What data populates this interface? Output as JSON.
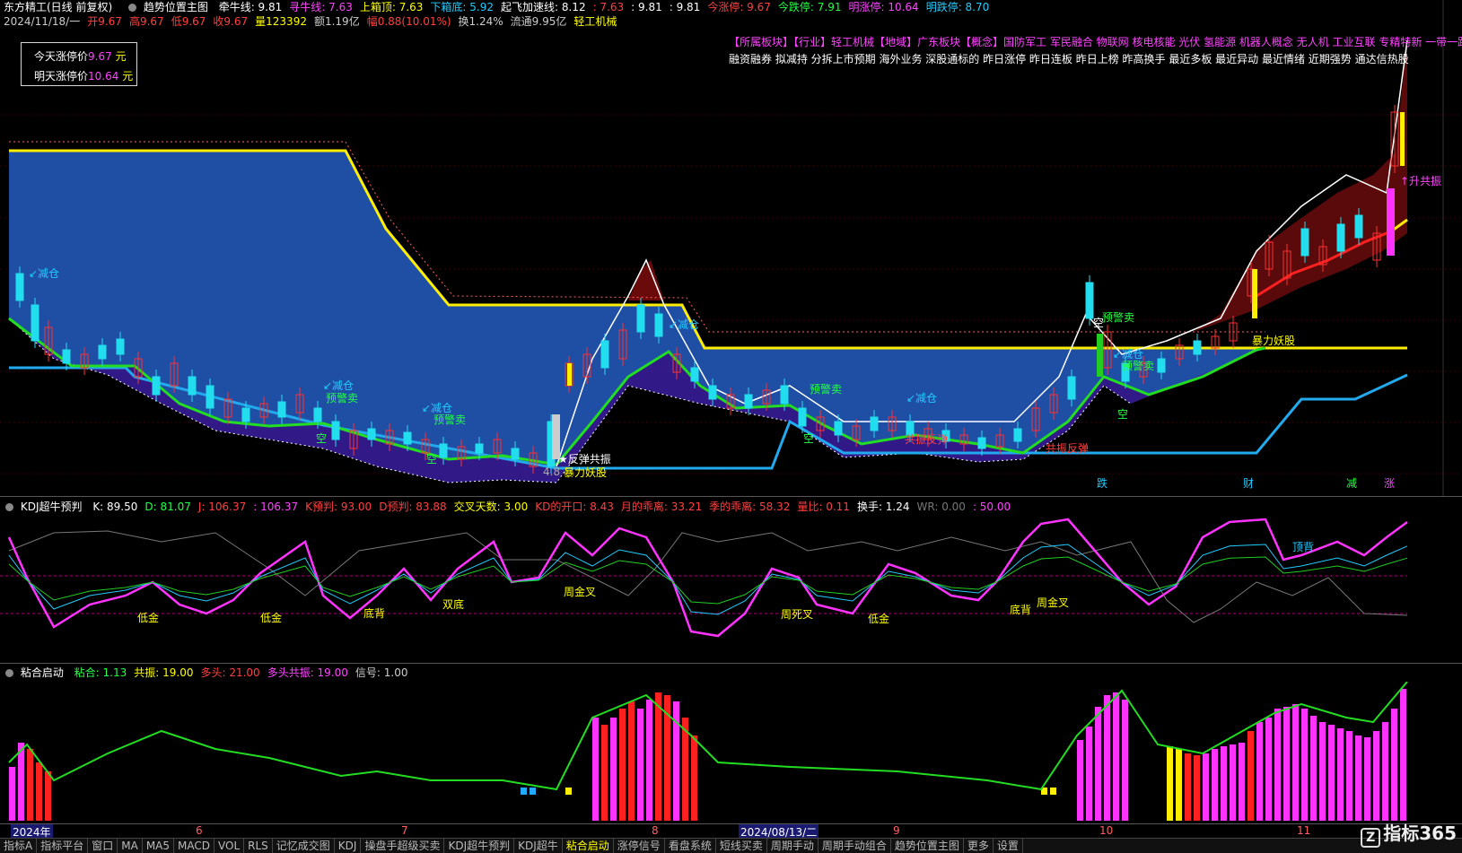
{
  "top": {
    "app": "东方精工(日线 前复权)",
    "indicator": "趋势位置主图",
    "items": [
      {
        "t": "牵牛线: 9.81",
        "c": "#ffffff"
      },
      {
        "t": "寻牛线: 7.63",
        "c": "#ff44ff"
      },
      {
        "t": "上箱顶: 7.63",
        "c": "#ffff00"
      },
      {
        "t": "下箱底: 5.92",
        "c": "#22ccff"
      },
      {
        "t": "起飞加速线: 8.12",
        "c": "#ffffff"
      },
      {
        "t": ": 7.63",
        "c": "#ff4040"
      },
      {
        "t": ": 9.81",
        "c": "#ffffff"
      },
      {
        "t": ": 9.81",
        "c": "#ffffff"
      },
      {
        "t": "今涨停: 9.67",
        "c": "#ff4040"
      },
      {
        "t": "今跌停: 7.91",
        "c": "#22ff44"
      },
      {
        "t": "明涨停: 10.64",
        "c": "#ff44ff"
      },
      {
        "t": "明跌停: 8.70",
        "c": "#22ccff"
      }
    ]
  },
  "quote": {
    "items": [
      {
        "t": "2024/11/18/一",
        "c": "#cccccc"
      },
      {
        "t": "开9.67",
        "c": "#ff4040"
      },
      {
        "t": "高9.67",
        "c": "#ff4040"
      },
      {
        "t": "低9.67",
        "c": "#ff4040"
      },
      {
        "t": "收9.67",
        "c": "#ff4040"
      },
      {
        "t": "量123392",
        "c": "#ffff00"
      },
      {
        "t": "额1.19亿",
        "c": "#cccccc"
      },
      {
        "t": "幅0.88(10.01%)",
        "c": "#ff4040"
      },
      {
        "t": "换1.24%",
        "c": "#cccccc"
      },
      {
        "t": "流通9.95亿",
        "c": "#cccccc"
      },
      {
        "t": "轻工机械",
        "c": "#ffff00"
      }
    ]
  },
  "price_box": {
    "today_label": "今天涨停价",
    "today_value": "9.67",
    "today_unit": "元",
    "tomorrow_label": "明天涨停价",
    "tomorrow_value": "10.64",
    "tomorrow_unit": "元"
  },
  "concepts": {
    "line1": "【所属板块】【行业】轻工机械【地域】广东板块【概念】国防军工 军民融合 物联网 核电核能 光伏 氢能源 机器人概念 无人机 工业互联 专精特新 一带一路",
    "line2": "融资融券 拟减持 分拆上市预期 海外业务 深股通标的 昨日涨停 昨日连板 昨日上榜 昨高换手 最近多板 最近异动 最近情绪 近期强势 通达信热股"
  },
  "annotations": [
    {
      "t": "↙减仓",
      "c": "#22ccff",
      "x": 32,
      "y": 308
    },
    {
      "t": "↙减仓",
      "c": "#22ccff",
      "x": 360,
      "y": 433
    },
    {
      "t": "预警卖",
      "c": "#22ff44",
      "x": 363,
      "y": 447
    },
    {
      "t": "↙减仓",
      "c": "#22ccff",
      "x": 470,
      "y": 458
    },
    {
      "t": "预警卖",
      "c": "#22ff44",
      "x": 483,
      "y": 471
    },
    {
      "t": "↙减仓",
      "c": "#22ccff",
      "x": 745,
      "y": 365
    },
    {
      "t": "预警卖",
      "c": "#22ff44",
      "x": 902,
      "y": 437
    },
    {
      "t": "↙减仓",
      "c": "#22ccff",
      "x": 1010,
      "y": 447
    },
    {
      "t": "预警卖",
      "c": "#22ff44",
      "x": 1228,
      "y": 357
    },
    {
      "t": "↙减仓",
      "c": "#22ccff",
      "x": 1240,
      "y": 398
    },
    {
      "t": "预警卖",
      "c": "#22ff44",
      "x": 1250,
      "y": 411
    },
    {
      "t": "暴力妖股",
      "c": "#ffff00",
      "x": 1395,
      "y": 383
    },
    {
      "t": "★反弹共振",
      "c": "#ffffff",
      "x": 622,
      "y": 515
    },
    {
      "t": "暴力妖股",
      "c": "#ffff00",
      "x": 628,
      "y": 530
    },
    {
      "t": "4.8",
      "c": "#aaaaaa",
      "x": 605,
      "y": 531
    },
    {
      "t": "空",
      "c": "#22ff44",
      "x": 352,
      "y": 492
    },
    {
      "t": "空",
      "c": "#22ff44",
      "x": 475,
      "y": 515
    },
    {
      "t": "空",
      "c": "#22ff44",
      "x": 895,
      "y": 492
    },
    {
      "t": "空",
      "c": "#22ff44",
      "x": 1245,
      "y": 465
    },
    {
      "t": "空",
      "c": "#ffffff",
      "x": 1218,
      "y": 363
    },
    {
      "t": "共振反弹",
      "c": "#ff4040",
      "x": 1165,
      "y": 503
    },
    {
      "t": "共振反弹",
      "c": "#ff4040",
      "x": 1008,
      "y": 493
    },
    {
      "t": "↑升共振",
      "c": "#ff44ff",
      "x": 1560,
      "y": 205
    },
    {
      "t": "跌",
      "c": "#22ccff",
      "x": 1222,
      "y": 542
    },
    {
      "t": "财",
      "c": "#22ccff",
      "x": 1385,
      "y": 542
    },
    {
      "t": "减",
      "c": "#22ff44",
      "x": 1500,
      "y": 542
    },
    {
      "t": "涨",
      "c": "#ff44ff",
      "x": 1542,
      "y": 542
    }
  ],
  "kdj": {
    "title": "KDJ超牛预判",
    "items": [
      {
        "t": "K: 89.50",
        "c": "#ffffff"
      },
      {
        "t": "D: 81.07",
        "c": "#22ff44"
      },
      {
        "t": "J: 106.37",
        "c": "#ff4040"
      },
      {
        "t": ": 106.37",
        "c": "#ff44ff"
      },
      {
        "t": "K预判: 93.00",
        "c": "#ff4040"
      },
      {
        "t": "D预判: 83.88",
        "c": "#ff4040"
      },
      {
        "t": "交叉天数: 3.00",
        "c": "#ffff00"
      },
      {
        "t": "KD的开口: 8.43",
        "c": "#ff4040"
      },
      {
        "t": "月的乖离: 33.21",
        "c": "#ff4040"
      },
      {
        "t": "季的乖离: 58.32",
        "c": "#ff4040"
      },
      {
        "t": "量比: 0.11",
        "c": "#ff4040"
      },
      {
        "t": "换手: 1.24",
        "c": "#ffffff"
      },
      {
        "t": "WR: 0.00",
        "c": "#777777"
      },
      {
        "t": ": 50.00",
        "c": "#ff44ff"
      }
    ],
    "labels": [
      {
        "t": "低金",
        "c": "#ffff00",
        "x": 153,
        "y": 692
      },
      {
        "t": "低金",
        "c": "#ffff00",
        "x": 290,
        "y": 692
      },
      {
        "t": "底背",
        "c": "#ffff00",
        "x": 405,
        "y": 687
      },
      {
        "t": "双底",
        "c": "#ffff00",
        "x": 493,
        "y": 677
      },
      {
        "t": "周金叉",
        "c": "#ffff00",
        "x": 628,
        "y": 663
      },
      {
        "t": "周死叉",
        "c": "#ffff00",
        "x": 870,
        "y": 688
      },
      {
        "t": "低金",
        "c": "#ffff00",
        "x": 967,
        "y": 693
      },
      {
        "t": "底背",
        "c": "#ffff00",
        "x": 1125,
        "y": 683
      },
      {
        "t": "周金叉",
        "c": "#ffff00",
        "x": 1155,
        "y": 675
      },
      {
        "t": "顶背",
        "c": "#22ccff",
        "x": 1440,
        "y": 613
      }
    ]
  },
  "nian": {
    "title": "粘合启动",
    "items": [
      {
        "t": "粘合: 1.13",
        "c": "#22ff44"
      },
      {
        "t": "共振: 19.00",
        "c": "#ffff00"
      },
      {
        "t": "多头: 21.00",
        "c": "#ff4040"
      },
      {
        "t": "多头共振: 19.00",
        "c": "#ff44ff"
      },
      {
        "t": "信号: 1.00",
        "c": "#cccccc"
      }
    ]
  },
  "axis": {
    "dates": [
      {
        "t": "2024年",
        "x": 12
      },
      {
        "t": "6",
        "x": 218
      },
      {
        "t": "7",
        "x": 447
      },
      {
        "t": "8",
        "x": 726
      },
      {
        "t": "2024/08/13/二",
        "x": 823
      },
      {
        "t": "9",
        "x": 995
      },
      {
        "t": "10",
        "x": 1225
      },
      {
        "t": "11",
        "x": 1445
      }
    ]
  },
  "tabs": [
    "指标A",
    "指标平台",
    "窗口",
    "MA",
    "MA5",
    "MACD",
    "VOL",
    "RLS",
    "记忆成交图",
    "KDJ",
    "操盘手超级买卖",
    "KDJ超牛预判",
    "KDJ超牛",
    "粘合启动",
    "涨停信号",
    "看盘系统",
    "短线买卖",
    "周期手动",
    "周期手动组合",
    "趋势位置主图",
    "更多",
    "设置"
  ],
  "active_tab": "粘合启动",
  "brand": "指标365",
  "chart_data": [
    {
      "type": "candlestick",
      "title": "趋势位置主图",
      "series": [
        {
          "name": "牵牛线",
          "last": 9.81
        },
        {
          "name": "寻牛线",
          "last": 7.63
        },
        {
          "name": "上箱顶",
          "last": 7.63
        },
        {
          "name": "下箱底",
          "last": 5.92
        },
        {
          "name": "起飞加速线",
          "last": 8.12
        }
      ]
    },
    {
      "type": "line",
      "title": "KDJ超牛预判",
      "series": [
        {
          "name": "K",
          "last": 89.5
        },
        {
          "name": "D",
          "last": 81.07
        },
        {
          "name": "J",
          "last": 106.37
        }
      ]
    },
    {
      "type": "bar",
      "title": "粘合启动",
      "series": [
        {
          "name": "粘合",
          "last": 1.13
        },
        {
          "name": "共振",
          "last": 19.0
        },
        {
          "name": "多头",
          "last": 21.0
        },
        {
          "name": "多头共振",
          "last": 19.0
        }
      ]
    }
  ]
}
